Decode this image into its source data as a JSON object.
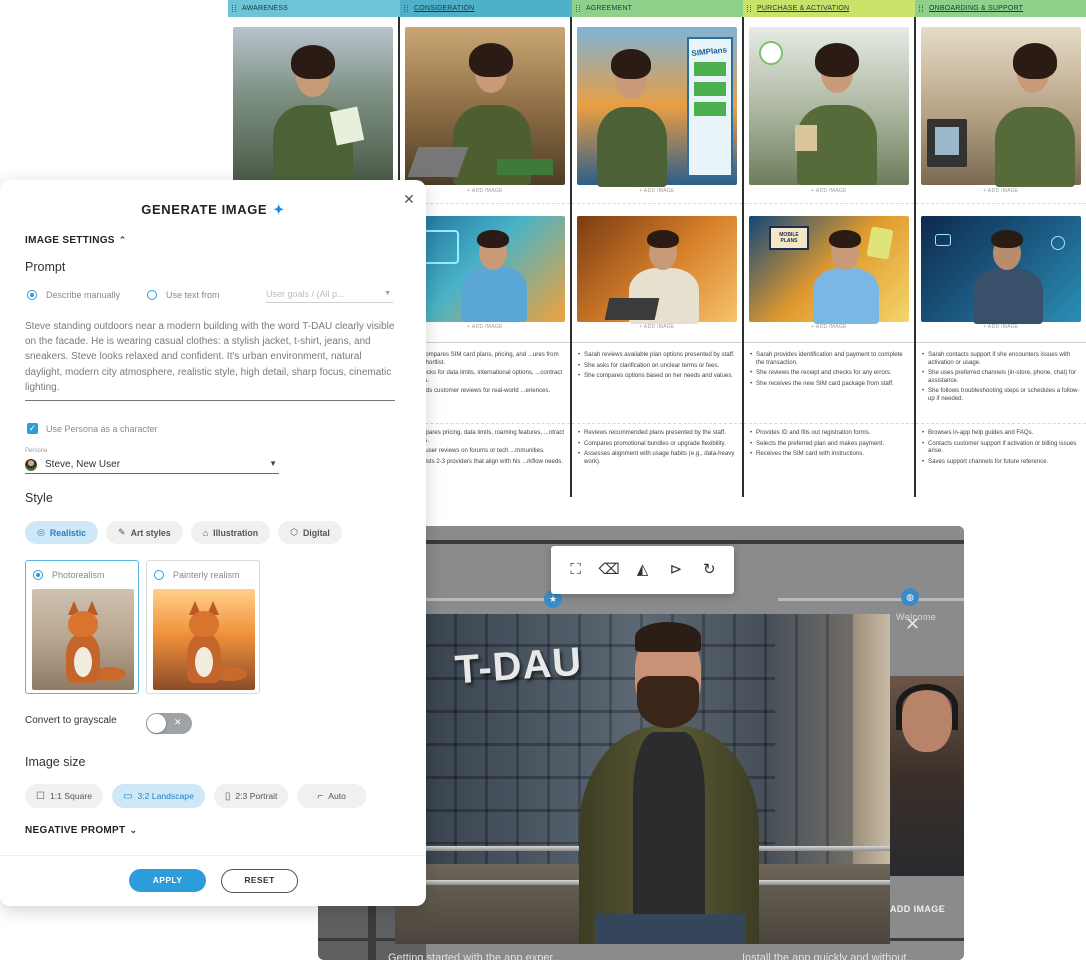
{
  "board": {
    "stages": [
      {
        "label": "AWARENESS",
        "color": "#6ec3d6",
        "underline": false
      },
      {
        "label": "CONSIDERATION",
        "color": "#4fb0c9",
        "underline": true
      },
      {
        "label": "AGREEMENT",
        "color": "#8fd08a",
        "underline": false
      },
      {
        "label": "PURCHASE & ACTIVATION",
        "color": "#c9e36a",
        "underline": true
      },
      {
        "label": "ONBOARDING & SUPPORT",
        "color": "#8fd08a",
        "underline": true
      }
    ],
    "add_image_label": "+ ADD IMAGE",
    "store_sign": "SIMPlans",
    "bubble_text": "MOBILE PLANS",
    "notes_row1": [
      [],
      [
        "...h compares SIM card plans, pricing, and ...ures from her shortlist.",
        "...checks for data limits, international options, ...contract terms.",
        "...reads customer reviews for real-world ...eriences."
      ],
      [
        "Sarah reviews available plan options presented by staff.",
        "She asks for clarification on unclear terms or fees.",
        "She compares options based on her needs and values."
      ],
      [
        "Sarah provides identification and payment to complete the transaction.",
        "She reviews the receipt and checks for any errors.",
        "She receives the new SIM card package from staff."
      ],
      [
        "Sarah contacts support if she encounters issues with activation or usage.",
        "She uses preferred channels (in-store, phone, chat) for assistance.",
        "She follows troubleshooting steps or schedules a follow-up if needed."
      ]
    ],
    "notes_row2": [
      [],
      [
        "...ompares pricing, data limits, roaming features, ...ntract terms.",
        "...ds user reviews on forums or tech ...mmunities.",
        "...ortlists 2-3 providers that align with his ...rkflow needs."
      ],
      [
        "Reviews recommended plans presented by the staff.",
        "Compares promotional bundles or upgrade flexibility.",
        "Assesses alignment with usage habits (e.g., data-heavy work)."
      ],
      [
        "Provides ID and fills out registration forms.",
        "Selects the preferred plan and makes payment.",
        "Receives the SIM card with instructions."
      ],
      [
        "Browses in-app help guides and FAQs.",
        "Contacts customer support if activation or billing issues arise.",
        "Saves support channels for future reference."
      ]
    ]
  },
  "panel": {
    "title": "GENERATE IMAGE",
    "image_settings": "IMAGE SETTINGS",
    "prompt_label": "Prompt",
    "describe_manually": "Describe manually",
    "use_text_from": "Use text from",
    "text_source_placeholder": "User goals / (All p...",
    "prompt_text": "Steve standing outdoors near a modern building with the word T-DAU clearly visible on the facade. He is wearing casual clothes: a stylish jacket, t-shirt, jeans, and sneakers. Steve looks relaxed and confident. It's urban environment, natural daylight, modern city atmosphere, realistic style, high detail, sharp focus, cinematic lighting.",
    "use_persona": "Use Persona as a character",
    "persona_label": "Persona",
    "persona_value": "Steve, New User",
    "style_label": "Style",
    "style_tabs": [
      {
        "label": "Realistic",
        "icon": "camera-icon",
        "active": true
      },
      {
        "label": "Art styles",
        "icon": "brush-icon",
        "active": false
      },
      {
        "label": "Illustration",
        "icon": "pen-tool-icon",
        "active": false
      },
      {
        "label": "Digital",
        "icon": "cube-icon",
        "active": false
      }
    ],
    "style_cards": [
      {
        "label": "Photorealism",
        "selected": true
      },
      {
        "label": "Painterly realism",
        "selected": false
      }
    ],
    "grayscale_label": "Convert to grayscale",
    "grayscale_on": false,
    "image_size_label": "Image size",
    "sizes": [
      {
        "label": "1:1 Square",
        "active": false
      },
      {
        "label": "3:2 Landscape",
        "active": true
      },
      {
        "label": "2:3 Portrait",
        "active": false
      },
      {
        "label": "Auto",
        "active": false
      }
    ],
    "negative_prompt": "NEGATIVE PROMPT",
    "apply": "APPLY",
    "reset": "RESET"
  },
  "editor": {
    "sign_text": "T-DAU",
    "add_image": "ADD IMAGE",
    "welcome": "Welcome",
    "bottom_left": "Getting started with the app exper...",
    "bottom_right": "Install the app quickly and without..."
  }
}
